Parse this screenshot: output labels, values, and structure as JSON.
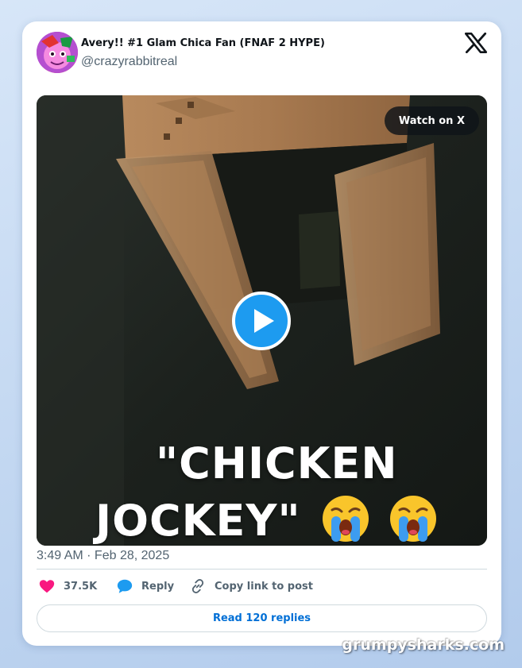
{
  "tweet": {
    "author_name": "Avery!! #1 Glam Chica Fan (FNAF 2 HYPE)",
    "author_handle": "@crazyrabbitreal",
    "timestamp": "3:49 AM · Feb 28, 2025",
    "platform_icon": "x-logo-icon"
  },
  "media": {
    "watch_label": "Watch on X",
    "caption_line1": "\"CHICKEN",
    "caption_line2": "JOCKEY\"",
    "caption_emoji": "loudly-crying-face",
    "play_icon": "play-icon"
  },
  "actions": {
    "like_count": "37.5K",
    "reply_label": "Reply",
    "copy_label": "Copy link to post"
  },
  "read_replies_label": "Read 120 replies",
  "watermark": "grumpysharks.com",
  "colors": {
    "accent_blue": "#1d9bf0",
    "link_blue": "#006fd6",
    "like_pink": "#f91880",
    "text_secondary": "#536471"
  }
}
